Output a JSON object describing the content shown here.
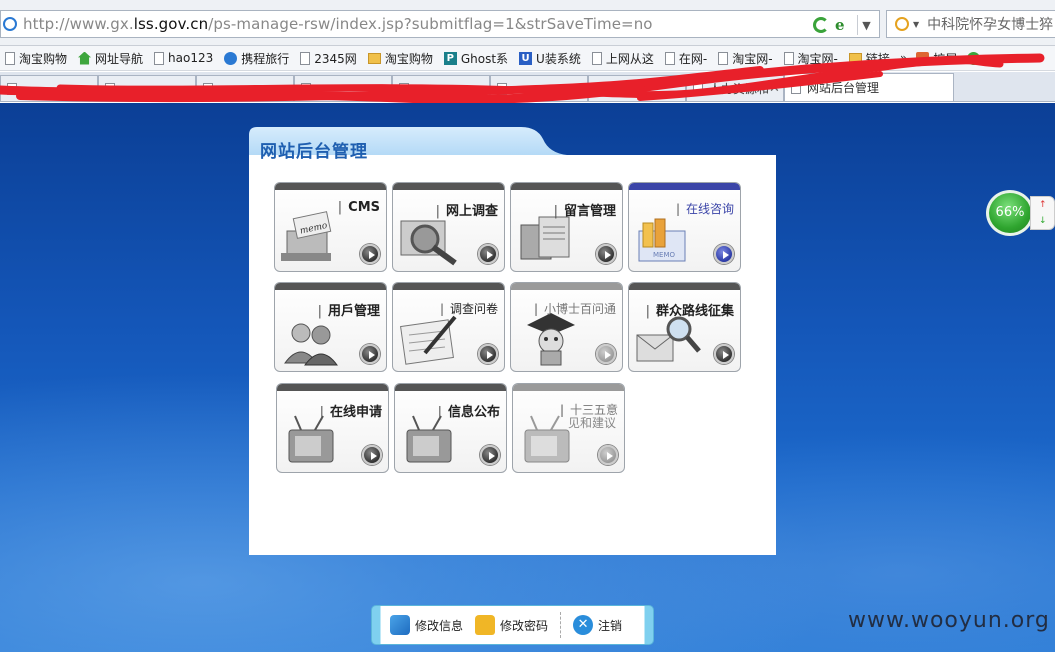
{
  "address_bar": {
    "url_prefix": "http://www.gx.",
    "url_host": "lss.gov.cn",
    "url_path": "/ps-manage-rsw/index.jsp?submitflag=1&strSaveTime=no"
  },
  "search": {
    "text": "中科院怀孕女博士猝"
  },
  "favorites": [
    {
      "label": "淘宝购物",
      "icon": "page-icon"
    },
    {
      "label": "网址导航",
      "icon": "house-icon"
    },
    {
      "label": "hao123",
      "icon": "page-icon"
    },
    {
      "label": "携程旅行",
      "icon": "globe-icon"
    },
    {
      "label": "2345网",
      "icon": "page-icon"
    },
    {
      "label": "淘宝购物",
      "icon": "folder-icon"
    },
    {
      "label": "Ghost系",
      "icon": "p-icon"
    },
    {
      "label": "U装系统",
      "icon": "u-icon"
    },
    {
      "label": "上网从这",
      "icon": "page-icon"
    },
    {
      "label": "在网-",
      "icon": "page-icon"
    },
    {
      "label": "淘宝网-",
      "icon": "page-icon"
    },
    {
      "label": "淘宝网-",
      "icon": "page-icon"
    },
    {
      "label": "链接",
      "icon": "folder-icon"
    }
  ],
  "favorites_more": "»",
  "favorites_extra": {
    "label": "扩展"
  },
  "tabs": [
    {
      "label": "",
      "active": false
    },
    {
      "label": "",
      "active": false
    },
    {
      "label": "",
      "active": false
    },
    {
      "label": "",
      "active": false
    },
    {
      "label": "",
      "active": false
    },
    {
      "label": "",
      "active": false
    },
    {
      "label": "",
      "active": false
    },
    {
      "label": "人力资源和",
      "active": false
    },
    {
      "label": "网站后台管理",
      "active": true
    }
  ],
  "tab_close": "✕",
  "panel": {
    "title": "网站后台管理"
  },
  "tiles": [
    {
      "label": "CMS",
      "style": "dark",
      "name": "tile-cms"
    },
    {
      "label": "网上调查",
      "style": "dark",
      "name": "tile-online-survey"
    },
    {
      "label": "留言管理",
      "style": "dark",
      "name": "tile-message-management"
    },
    {
      "label": "在线咨询",
      "style": "blue",
      "name": "tile-online-consult"
    },
    {
      "label": "用戶管理",
      "style": "dark",
      "name": "tile-user-management"
    },
    {
      "label": "调查问卷",
      "style": "small",
      "name": "tile-questionnaire"
    },
    {
      "label": "小博士百问通",
      "style": "gray",
      "name": "tile-little-doctor"
    },
    {
      "label": "群众路线征集",
      "style": "dark",
      "name": "tile-mass-line"
    },
    {
      "label": "在线申请",
      "style": "dark",
      "name": "tile-online-apply"
    },
    {
      "label": "信息公布",
      "style": "dark",
      "name": "tile-info-publish"
    },
    {
      "label": "十三五意",
      "label2": "见和建议",
      "style": "gray",
      "name": "tile-13th-five-year"
    }
  ],
  "toolbar": {
    "edit_info": "修改信息",
    "change_password": "修改密码",
    "logout": "注销"
  },
  "speed_widget": {
    "value": "66%",
    "up_label": "↑",
    "down_label": "↓"
  },
  "watermark": "www.wooyun.org"
}
